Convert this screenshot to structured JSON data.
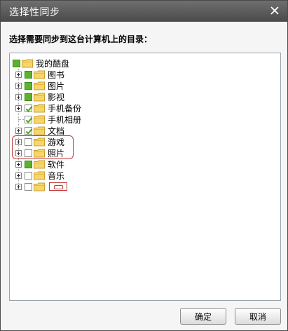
{
  "dialog": {
    "title": "选择性同步",
    "prompt": "选择需要同步到这台计算机上的目录："
  },
  "tree": {
    "root": {
      "label": "我的酷盘",
      "check_state": "partial"
    },
    "items": [
      {
        "label": "图书",
        "check_state": "partial",
        "expandable": true
      },
      {
        "label": "图片",
        "check_state": "partial",
        "expandable": true
      },
      {
        "label": "影视",
        "check_state": "partial",
        "expandable": true
      },
      {
        "label": "手机备份",
        "check_state": "checked",
        "expandable": true
      },
      {
        "label": "手机相册",
        "check_state": "checked",
        "expandable": false
      },
      {
        "label": "文档",
        "check_state": "checked",
        "expandable": true
      },
      {
        "label": "游戏",
        "check_state": "unchecked",
        "expandable": true
      },
      {
        "label": "照片",
        "check_state": "unchecked",
        "expandable": true
      },
      {
        "label": "软件",
        "check_state": "partial",
        "expandable": true
      },
      {
        "label": "音乐",
        "check_state": "unchecked",
        "expandable": true
      },
      {
        "label": "",
        "check_state": "unchecked",
        "expandable": true
      }
    ]
  },
  "buttons": {
    "ok": "确定",
    "cancel": "取消"
  },
  "colors": {
    "titlebar": "#5a5a5a",
    "check_green": "#5cb22c",
    "highlight_red": "#c0393b"
  }
}
